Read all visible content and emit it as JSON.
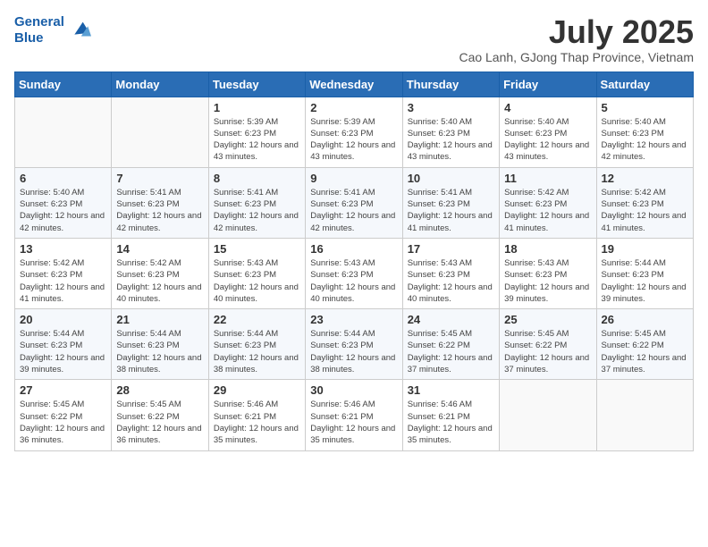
{
  "header": {
    "logo_line1": "General",
    "logo_line2": "Blue",
    "month_year": "July 2025",
    "location": "Cao Lanh, GJong Thap Province, Vietnam"
  },
  "columns": [
    "Sunday",
    "Monday",
    "Tuesday",
    "Wednesday",
    "Thursday",
    "Friday",
    "Saturday"
  ],
  "weeks": [
    [
      {
        "day": "",
        "info": ""
      },
      {
        "day": "",
        "info": ""
      },
      {
        "day": "1",
        "info": "Sunrise: 5:39 AM\nSunset: 6:23 PM\nDaylight: 12 hours and 43 minutes."
      },
      {
        "day": "2",
        "info": "Sunrise: 5:39 AM\nSunset: 6:23 PM\nDaylight: 12 hours and 43 minutes."
      },
      {
        "day": "3",
        "info": "Sunrise: 5:40 AM\nSunset: 6:23 PM\nDaylight: 12 hours and 43 minutes."
      },
      {
        "day": "4",
        "info": "Sunrise: 5:40 AM\nSunset: 6:23 PM\nDaylight: 12 hours and 43 minutes."
      },
      {
        "day": "5",
        "info": "Sunrise: 5:40 AM\nSunset: 6:23 PM\nDaylight: 12 hours and 42 minutes."
      }
    ],
    [
      {
        "day": "6",
        "info": "Sunrise: 5:40 AM\nSunset: 6:23 PM\nDaylight: 12 hours and 42 minutes."
      },
      {
        "day": "7",
        "info": "Sunrise: 5:41 AM\nSunset: 6:23 PM\nDaylight: 12 hours and 42 minutes."
      },
      {
        "day": "8",
        "info": "Sunrise: 5:41 AM\nSunset: 6:23 PM\nDaylight: 12 hours and 42 minutes."
      },
      {
        "day": "9",
        "info": "Sunrise: 5:41 AM\nSunset: 6:23 PM\nDaylight: 12 hours and 42 minutes."
      },
      {
        "day": "10",
        "info": "Sunrise: 5:41 AM\nSunset: 6:23 PM\nDaylight: 12 hours and 41 minutes."
      },
      {
        "day": "11",
        "info": "Sunrise: 5:42 AM\nSunset: 6:23 PM\nDaylight: 12 hours and 41 minutes."
      },
      {
        "day": "12",
        "info": "Sunrise: 5:42 AM\nSunset: 6:23 PM\nDaylight: 12 hours and 41 minutes."
      }
    ],
    [
      {
        "day": "13",
        "info": "Sunrise: 5:42 AM\nSunset: 6:23 PM\nDaylight: 12 hours and 41 minutes."
      },
      {
        "day": "14",
        "info": "Sunrise: 5:42 AM\nSunset: 6:23 PM\nDaylight: 12 hours and 40 minutes."
      },
      {
        "day": "15",
        "info": "Sunrise: 5:43 AM\nSunset: 6:23 PM\nDaylight: 12 hours and 40 minutes."
      },
      {
        "day": "16",
        "info": "Sunrise: 5:43 AM\nSunset: 6:23 PM\nDaylight: 12 hours and 40 minutes."
      },
      {
        "day": "17",
        "info": "Sunrise: 5:43 AM\nSunset: 6:23 PM\nDaylight: 12 hours and 40 minutes."
      },
      {
        "day": "18",
        "info": "Sunrise: 5:43 AM\nSunset: 6:23 PM\nDaylight: 12 hours and 39 minutes."
      },
      {
        "day": "19",
        "info": "Sunrise: 5:44 AM\nSunset: 6:23 PM\nDaylight: 12 hours and 39 minutes."
      }
    ],
    [
      {
        "day": "20",
        "info": "Sunrise: 5:44 AM\nSunset: 6:23 PM\nDaylight: 12 hours and 39 minutes."
      },
      {
        "day": "21",
        "info": "Sunrise: 5:44 AM\nSunset: 6:23 PM\nDaylight: 12 hours and 38 minutes."
      },
      {
        "day": "22",
        "info": "Sunrise: 5:44 AM\nSunset: 6:23 PM\nDaylight: 12 hours and 38 minutes."
      },
      {
        "day": "23",
        "info": "Sunrise: 5:44 AM\nSunset: 6:23 PM\nDaylight: 12 hours and 38 minutes."
      },
      {
        "day": "24",
        "info": "Sunrise: 5:45 AM\nSunset: 6:22 PM\nDaylight: 12 hours and 37 minutes."
      },
      {
        "day": "25",
        "info": "Sunrise: 5:45 AM\nSunset: 6:22 PM\nDaylight: 12 hours and 37 minutes."
      },
      {
        "day": "26",
        "info": "Sunrise: 5:45 AM\nSunset: 6:22 PM\nDaylight: 12 hours and 37 minutes."
      }
    ],
    [
      {
        "day": "27",
        "info": "Sunrise: 5:45 AM\nSunset: 6:22 PM\nDaylight: 12 hours and 36 minutes."
      },
      {
        "day": "28",
        "info": "Sunrise: 5:45 AM\nSunset: 6:22 PM\nDaylight: 12 hours and 36 minutes."
      },
      {
        "day": "29",
        "info": "Sunrise: 5:46 AM\nSunset: 6:21 PM\nDaylight: 12 hours and 35 minutes."
      },
      {
        "day": "30",
        "info": "Sunrise: 5:46 AM\nSunset: 6:21 PM\nDaylight: 12 hours and 35 minutes."
      },
      {
        "day": "31",
        "info": "Sunrise: 5:46 AM\nSunset: 6:21 PM\nDaylight: 12 hours and 35 minutes."
      },
      {
        "day": "",
        "info": ""
      },
      {
        "day": "",
        "info": ""
      }
    ]
  ]
}
